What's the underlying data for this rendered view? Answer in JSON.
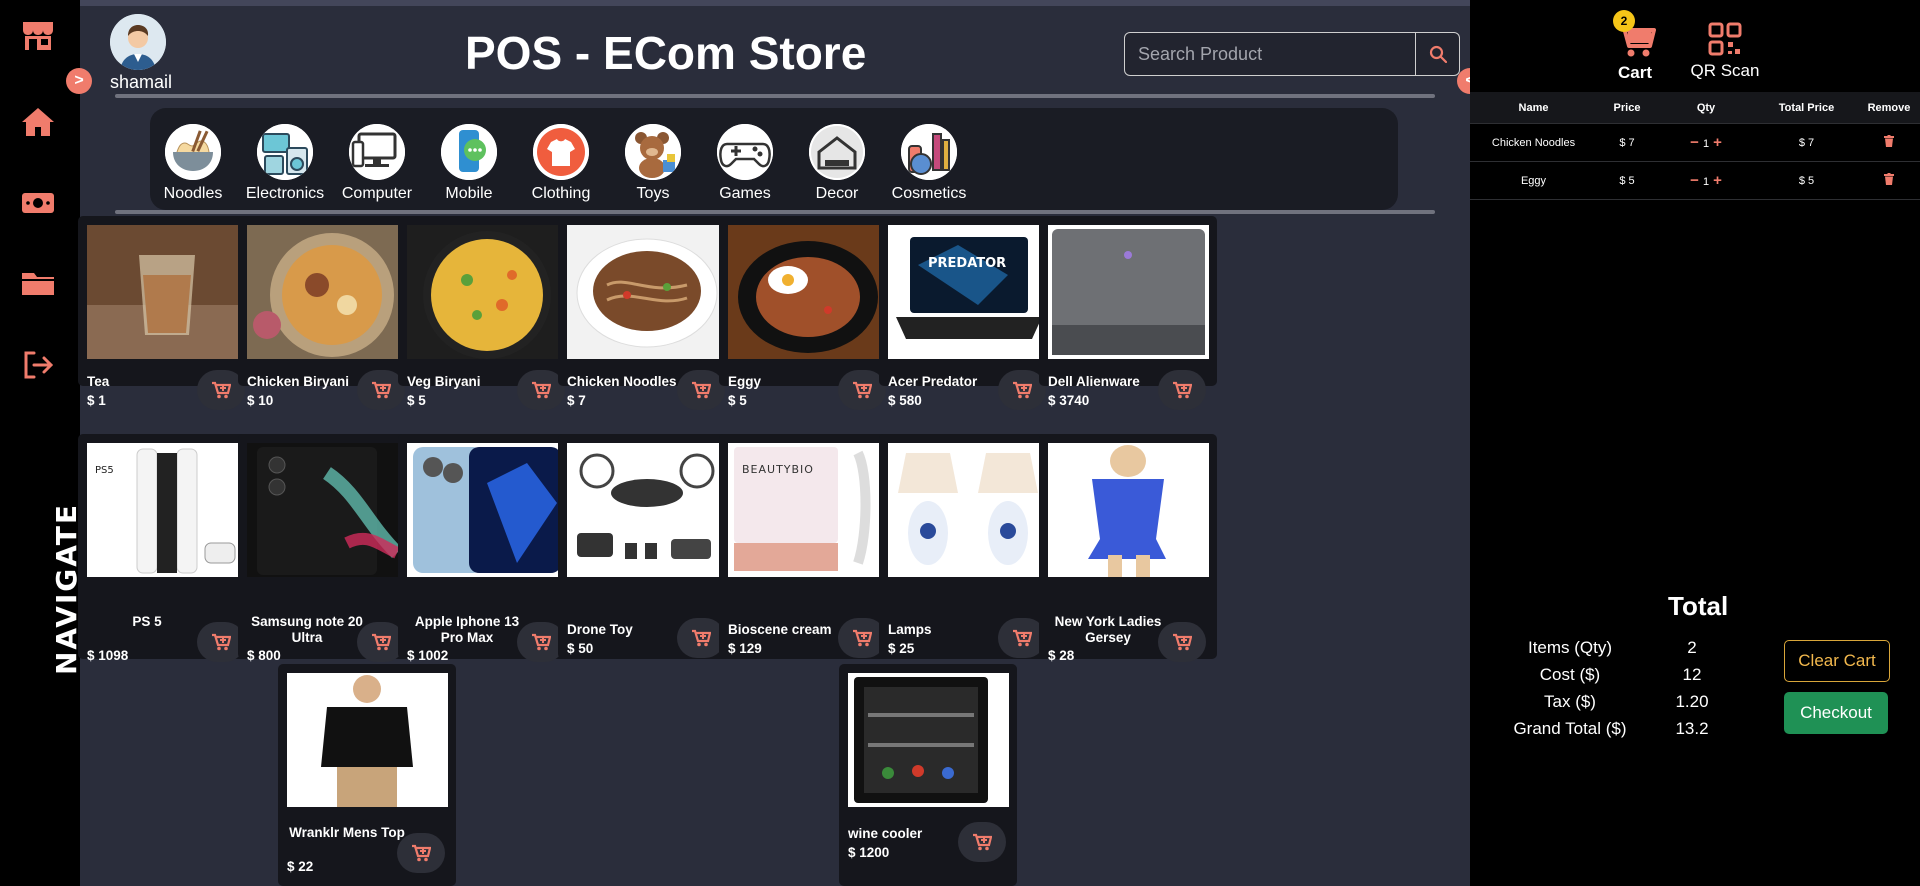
{
  "user": {
    "name": "shamail"
  },
  "header": {
    "title": "POS - ECom Store"
  },
  "search": {
    "placeholder": "Search Product",
    "value": ""
  },
  "nav": {
    "label": "NAVIGATE",
    "items": [
      {
        "icon": "store-icon"
      },
      {
        "icon": "home-icon"
      },
      {
        "icon": "cash-icon"
      },
      {
        "icon": "folder-icon"
      },
      {
        "icon": "logout-icon"
      }
    ]
  },
  "categories": [
    {
      "label": "Noodles",
      "icon": "noodles-icon"
    },
    {
      "label": "Electronics",
      "icon": "electronics-icon"
    },
    {
      "label": "Computer",
      "icon": "computer-icon"
    },
    {
      "label": "Mobile",
      "icon": "mobile-icon"
    },
    {
      "label": "Clothing",
      "icon": "clothing-icon"
    },
    {
      "label": "Toys",
      "icon": "toys-icon"
    },
    {
      "label": "Games",
      "icon": "games-icon"
    },
    {
      "label": "Decor",
      "icon": "decor-icon"
    },
    {
      "label": "Cosmetics",
      "icon": "cosmetics-icon"
    }
  ],
  "products": [
    {
      "name": "Tea",
      "price": "$ 1"
    },
    {
      "name": "Chicken Biryani",
      "price": "$ 10"
    },
    {
      "name": "Veg Biryani",
      "price": "$ 5"
    },
    {
      "name": "Chicken Noodles",
      "price": "$ 7"
    },
    {
      "name": "Eggy",
      "price": "$ 5"
    },
    {
      "name": "Acer Predator",
      "price": "$ 580",
      "image_text": "PREDATOR"
    },
    {
      "name": "Dell Alienware",
      "price": "$ 3740"
    },
    {
      "name": "PS 5",
      "price": "$ 1098",
      "image_text": "PS5"
    },
    {
      "name": "Samsung note 20 Ultra",
      "price": "$ 800"
    },
    {
      "name": "Apple Iphone 13 Pro Max",
      "price": "$ 1002"
    },
    {
      "name": "Drone Toy",
      "price": "$ 50"
    },
    {
      "name": "Bioscene cream",
      "price": "$ 129",
      "image_text": "BEAUTYBIO"
    },
    {
      "name": "Lamps",
      "price": "$ 25"
    },
    {
      "name": "New York Ladies Gersey",
      "price": "$ 28"
    },
    {
      "name": "Wranklr Mens Top",
      "price": "$ 22"
    },
    {
      "name": "wine cooler",
      "price": "$ 1200"
    }
  ],
  "cart": {
    "label": "Cart",
    "badge": "2",
    "qr_label": "QR Scan",
    "columns": {
      "name": "Name",
      "price": "Price",
      "qty": "Qty",
      "total": "Total Price",
      "remove": "Remove"
    },
    "items": [
      {
        "name": "Chicken Noodles",
        "price": "$ 7",
        "qty": "1",
        "total": "$ 7"
      },
      {
        "name": "Eggy",
        "price": "$ 5",
        "qty": "1",
        "total": "$ 5"
      }
    ],
    "summary": {
      "title": "Total",
      "rows": [
        {
          "label": "Items (Qty)",
          "value": "2"
        },
        {
          "label": "Cost ($)",
          "value": "12"
        },
        {
          "label": "Tax ($)",
          "value": "1.20"
        },
        {
          "label": "Grand Total ($)",
          "value": "13.2"
        }
      ]
    },
    "clear_label": "Clear Cart",
    "checkout_label": "Checkout"
  },
  "colors": {
    "accent": "#f07c6c",
    "background": "#2a2d3b",
    "card": "#15161c",
    "checkout": "#1f9155",
    "badge": "#f5c518"
  }
}
